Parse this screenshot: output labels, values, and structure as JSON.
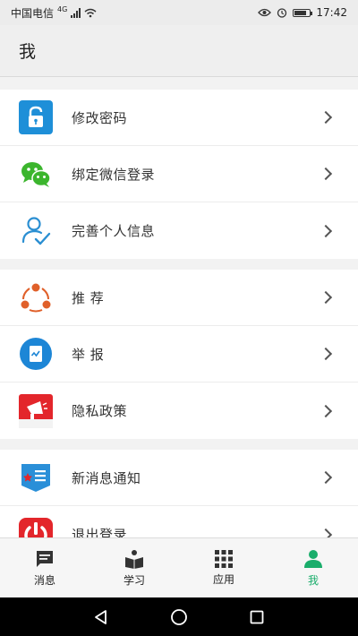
{
  "status_bar": {
    "carrier": "中国电信",
    "network": "4G",
    "time": "17:42"
  },
  "header": {
    "title": "我"
  },
  "groups": [
    {
      "items": [
        {
          "label": "修改密码",
          "icon": "lock-icon",
          "color": "#1e8fd8"
        },
        {
          "label": "绑定微信登录",
          "icon": "wechat-icon",
          "color": "#3bb52d"
        },
        {
          "label": "完善个人信息",
          "icon": "user-check-icon",
          "color": "#2b8fd2"
        }
      ]
    },
    {
      "items": [
        {
          "label": "推 荐",
          "icon": "share-icon",
          "color": "#e0602a"
        },
        {
          "label": "举 报",
          "icon": "report-icon",
          "color": "#1d86d6"
        },
        {
          "label": "隐私政策",
          "icon": "privacy-icon",
          "color": "#e3262b"
        }
      ]
    },
    {
      "items": [
        {
          "label": "新消息通知",
          "icon": "notification-icon",
          "color": "#2a8fd8"
        },
        {
          "label": "退出登录",
          "icon": "power-icon",
          "color": "#e3262b"
        }
      ]
    }
  ],
  "tabs": [
    {
      "label": "消息",
      "icon": "message-icon"
    },
    {
      "label": "学习",
      "icon": "book-icon"
    },
    {
      "label": "应用",
      "icon": "grid-icon"
    },
    {
      "label": "我",
      "icon": "person-icon",
      "active": true
    }
  ],
  "colors": {
    "accent": "#1aad6b"
  }
}
